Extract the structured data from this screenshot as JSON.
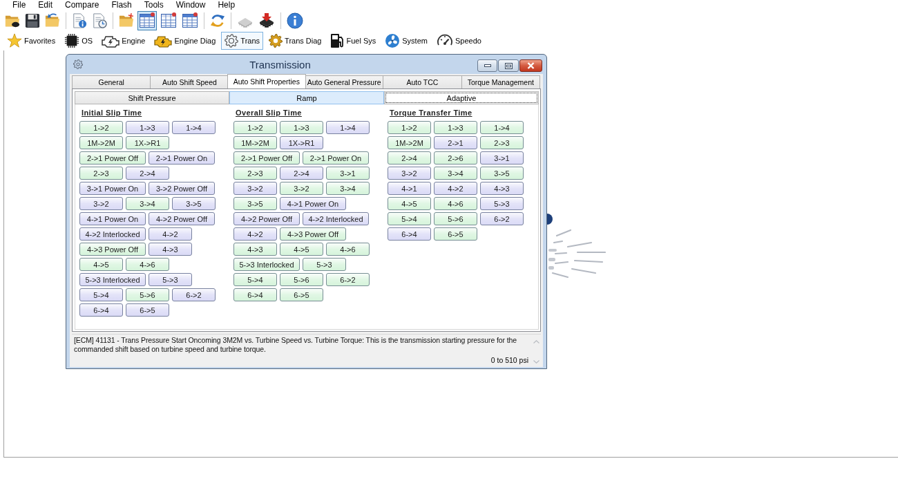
{
  "menu": [
    "File",
    "Edit",
    "Compare",
    "Flash",
    "Tools",
    "Window",
    "Help"
  ],
  "toolbar": [
    [
      {
        "pressed": false,
        "disabled": false
      },
      {
        "pressed": false,
        "disabled": false
      },
      {
        "pressed": false,
        "disabled": false
      }
    ],
    [
      {
        "pressed": false,
        "disabled": false
      },
      {
        "pressed": false,
        "disabled": false
      }
    ],
    [
      {
        "pressed": false,
        "disabled": false
      },
      {
        "pressed": true,
        "disabled": false
      },
      {
        "pressed": false,
        "disabled": false
      },
      {
        "pressed": false,
        "disabled": false
      }
    ],
    [
      {
        "pressed": false,
        "disabled": false
      }
    ],
    [
      {
        "pressed": false,
        "disabled": true
      },
      {
        "pressed": false,
        "disabled": false
      }
    ],
    [
      {
        "pressed": false,
        "disabled": false
      }
    ]
  ],
  "modules": [
    {
      "label": "Favorites",
      "selected": false
    },
    {
      "label": "OS",
      "selected": false
    },
    {
      "label": "Engine",
      "selected": false
    },
    {
      "label": "Engine Diag",
      "selected": false
    },
    {
      "label": "Trans",
      "selected": true
    },
    {
      "label": "Trans Diag",
      "selected": false
    },
    {
      "label": "Fuel Sys",
      "selected": false
    },
    {
      "label": "System",
      "selected": false
    },
    {
      "label": "Speedo",
      "selected": false
    }
  ],
  "window": {
    "title": "Transmission",
    "tabs": [
      {
        "label": "General",
        "selected": false
      },
      {
        "label": "Auto Shift Speed",
        "selected": false
      },
      {
        "label": "Auto Shift Properties",
        "selected": true
      },
      {
        "label": "Auto General Pressure",
        "selected": false
      },
      {
        "label": "Auto TCC",
        "selected": false
      },
      {
        "label": "Torque Management",
        "selected": false
      }
    ],
    "subtabs": [
      {
        "label": "Shift Pressure",
        "selected": false,
        "hovered": false
      },
      {
        "label": "Ramp",
        "selected": false,
        "hovered": true
      },
      {
        "label": "Adaptive",
        "selected": true,
        "hovered": false
      }
    ],
    "groups": [
      {
        "title": "Initial Slip Time",
        "buttons": [
          {
            "label": "1->2",
            "kind": "short",
            "color": "#d6f4db"
          },
          {
            "label": "1->3",
            "kind": "short",
            "color": "#dadaf6"
          },
          {
            "label": "1->4",
            "kind": "short",
            "color": "#dadaf6"
          },
          {
            "label": "1M->2M",
            "kind": "short",
            "color": "#d6f4db"
          },
          {
            "label": "1X->R1",
            "kind": "short",
            "color": "#d6f4db"
          },
          {
            "label": "2->1 Power Off",
            "kind": "long",
            "color": "#d6f4db"
          },
          {
            "label": "2->1 Power On",
            "kind": "long",
            "color": "#dadaf6"
          },
          {
            "label": "2->3",
            "kind": "short",
            "color": "#d6f4db"
          },
          {
            "label": "2->4",
            "kind": "short",
            "color": "#dadaf6"
          },
          {
            "label": "3->1 Power On",
            "kind": "long",
            "color": "#dadaf6"
          },
          {
            "label": "3->2 Power Off",
            "kind": "long",
            "color": "#dadaf6"
          },
          {
            "label": "3->2",
            "kind": "short",
            "color": "#dadaf6"
          },
          {
            "label": "3->4",
            "kind": "short",
            "color": "#d6f4db"
          },
          {
            "label": "3->5",
            "kind": "short",
            "color": "#dadaf6"
          },
          {
            "label": "4->1 Power On",
            "kind": "long",
            "color": "#dadaf6"
          },
          {
            "label": "4->2 Power Off",
            "kind": "long",
            "color": "#dadaf6"
          },
          {
            "label": "4->2 Interlocked",
            "kind": "long",
            "color": "#dadaf6"
          },
          {
            "label": "4->2",
            "kind": "short",
            "color": "#dadaf6"
          },
          {
            "label": "4->3 Power Off",
            "kind": "long",
            "color": "#d6f4db"
          },
          {
            "label": "4->3",
            "kind": "short",
            "color": "#dadaf6"
          },
          {
            "label": "4->5",
            "kind": "short",
            "color": "#d6f4db"
          },
          {
            "label": "4->6",
            "kind": "short",
            "color": "#d6f4db"
          },
          {
            "label": "5->3 Interlocked",
            "kind": "long",
            "color": "#dadaf6"
          },
          {
            "label": "5->3",
            "kind": "short",
            "color": "#dadaf6"
          },
          {
            "label": "5->4",
            "kind": "short",
            "color": "#dadaf6"
          },
          {
            "label": "5->6",
            "kind": "short",
            "color": "#d6f4db"
          },
          {
            "label": "6->2",
            "kind": "short",
            "color": "#dadaf6"
          },
          {
            "label": "6->4",
            "kind": "short",
            "color": "#dadaf6"
          },
          {
            "label": "6->5",
            "kind": "short",
            "color": "#dadaf6"
          }
        ]
      },
      {
        "title": "Overall Slip Time",
        "buttons": [
          {
            "label": "1->2",
            "kind": "short",
            "color": "#d6f4db"
          },
          {
            "label": "1->3",
            "kind": "short",
            "color": "#d6f4db"
          },
          {
            "label": "1->4",
            "kind": "short",
            "color": "#dadaf6"
          },
          {
            "label": "1M->2M",
            "kind": "short",
            "color": "#d6f4db"
          },
          {
            "label": "1X->R1",
            "kind": "short",
            "color": "#dadaf6"
          },
          {
            "label": "2->1 Power Off",
            "kind": "long",
            "color": "#d6f4db"
          },
          {
            "label": "2->1 Power On",
            "kind": "long",
            "color": "#d6f4db"
          },
          {
            "label": "2->3",
            "kind": "short",
            "color": "#d6f4db"
          },
          {
            "label": "2->4",
            "kind": "short",
            "color": "#dadaf6"
          },
          {
            "label": "3->1",
            "kind": "short",
            "color": "#d6f4db"
          },
          {
            "label": "3->2",
            "kind": "short",
            "color": "#dadaf6"
          },
          {
            "label": "3->2",
            "kind": "short",
            "color": "#d6f4db"
          },
          {
            "label": "3->4",
            "kind": "short",
            "color": "#d6f4db"
          },
          {
            "label": "3->5",
            "kind": "short",
            "color": "#d6f4db"
          },
          {
            "label": "4->1 Power On",
            "kind": "long",
            "color": "#dadaf6"
          },
          {
            "label": "4->2 Power Off",
            "kind": "long",
            "color": "#dadaf6"
          },
          {
            "label": "4->2 Interlocked",
            "kind": "long",
            "color": "#dadaf6"
          },
          {
            "label": "4->2",
            "kind": "short",
            "color": "#dadaf6"
          },
          {
            "label": "4->3 Power Off",
            "kind": "long",
            "color": "#d6f4db"
          },
          {
            "label": "4->3",
            "kind": "short",
            "color": "#d6f4db"
          },
          {
            "label": "4->5",
            "kind": "short",
            "color": "#d6f4db"
          },
          {
            "label": "4->6",
            "kind": "short",
            "color": "#d6f4db"
          },
          {
            "label": "5->3 Interlocked",
            "kind": "long",
            "color": "#d6f4db"
          },
          {
            "label": "5->3",
            "kind": "short",
            "color": "#d6f4db"
          },
          {
            "label": "5->4",
            "kind": "short",
            "color": "#d6f4db"
          },
          {
            "label": "5->6",
            "kind": "short",
            "color": "#d6f4db"
          },
          {
            "label": "6->2",
            "kind": "short",
            "color": "#d6f4db"
          },
          {
            "label": "6->4",
            "kind": "short",
            "color": "#d6f4db"
          },
          {
            "label": "6->5",
            "kind": "short",
            "color": "#d6f4db"
          }
        ]
      },
      {
        "title": "Torque Transfer Time",
        "buttons": [
          {
            "label": "1->2",
            "kind": "short",
            "color": "#d6f4db"
          },
          {
            "label": "1->3",
            "kind": "short",
            "color": "#d6f4db"
          },
          {
            "label": "1->4",
            "kind": "short",
            "color": "#d6f4db"
          },
          {
            "label": "1M->2M",
            "kind": "short",
            "color": "#d6f4db"
          },
          {
            "label": "2->1",
            "kind": "short",
            "color": "#dadaf6"
          },
          {
            "label": "2->3",
            "kind": "short",
            "color": "#d6f4db"
          },
          {
            "label": "2->4",
            "kind": "short",
            "color": "#d6f4db"
          },
          {
            "label": "2->6",
            "kind": "short",
            "color": "#d6f4db"
          },
          {
            "label": "3->1",
            "kind": "short",
            "color": "#dadaf6"
          },
          {
            "label": "3->2",
            "kind": "short",
            "color": "#dadaf6"
          },
          {
            "label": "3->4",
            "kind": "short",
            "color": "#d6f4db"
          },
          {
            "label": "3->5",
            "kind": "short",
            "color": "#d6f4db"
          },
          {
            "label": "4->1",
            "kind": "short",
            "color": "#dadaf6"
          },
          {
            "label": "4->2",
            "kind": "short",
            "color": "#dadaf6"
          },
          {
            "label": "4->3",
            "kind": "short",
            "color": "#dadaf6"
          },
          {
            "label": "4->5",
            "kind": "short",
            "color": "#d6f4db"
          },
          {
            "label": "4->6",
            "kind": "short",
            "color": "#d6f4db"
          },
          {
            "label": "5->3",
            "kind": "short",
            "color": "#dadaf6"
          },
          {
            "label": "5->4",
            "kind": "short",
            "color": "#d6f4db"
          },
          {
            "label": "5->6",
            "kind": "short",
            "color": "#d6f4db"
          },
          {
            "label": "6->2",
            "kind": "short",
            "color": "#dadaf6"
          },
          {
            "label": "6->4",
            "kind": "short",
            "color": "#dadaf6"
          },
          {
            "label": "6->5",
            "kind": "short",
            "color": "#d6f4db"
          }
        ]
      }
    ],
    "description": {
      "text": "[ECM] 41131 - Trans Pressure Start Oncoming 3M2M vs. Turbine Speed vs. Turbine Torque: This is the transmission starting pressure for the commanded shift based on turbine speed and turbine torque.",
      "range": "0 to 510 psi"
    }
  }
}
